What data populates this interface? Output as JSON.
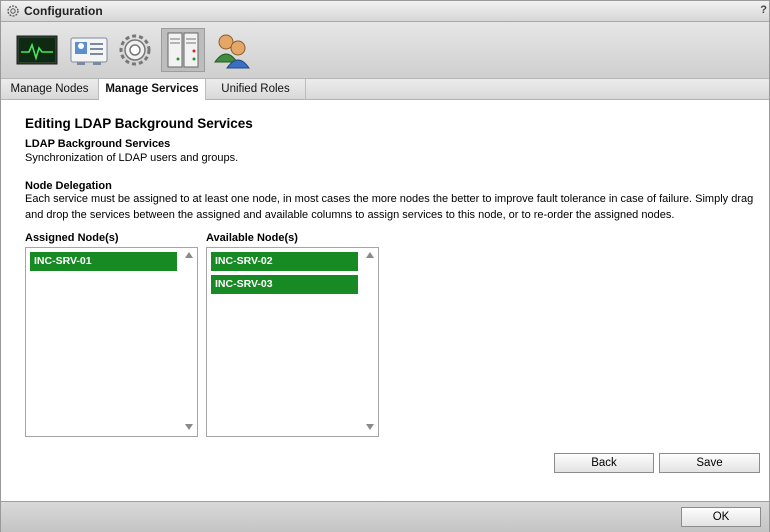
{
  "window": {
    "title": "Configuration",
    "help": "?"
  },
  "toolbar": {
    "icons": [
      "monitor-icon",
      "contact-card-icon",
      "gear-icon",
      "server-icon",
      "users-icon"
    ],
    "active": "server-icon"
  },
  "tabs": [
    {
      "label": "Manage Nodes",
      "active": false
    },
    {
      "label": "Manage Services",
      "active": true
    },
    {
      "label": "Unified Roles",
      "active": false
    }
  ],
  "page": {
    "title": "Editing LDAP Background Services",
    "service_title": "LDAP Background Services",
    "service_desc": "Synchronization of LDAP users and groups.",
    "delegation_title": "Node Delegation",
    "delegation_text": "Each service must be assigned to at least one node, in most cases the more nodes the better to improve fault tolerance in case of failure. Simply drag and drop the services between the assigned and available columns to assign services to this node, or to re-order the assigned nodes."
  },
  "assigned": {
    "label": "Assigned Node(s)",
    "nodes": [
      "INC-SRV-01"
    ]
  },
  "available": {
    "label": "Available Node(s)",
    "nodes": [
      "INC-SRV-02",
      "INC-SRV-03"
    ]
  },
  "buttons": {
    "back": "Back",
    "save": "Save",
    "ok": "OK"
  },
  "colors": {
    "node_bg": "#178a24",
    "window_bg": "#ffffff",
    "bar_bg": "#d0d0d0"
  }
}
